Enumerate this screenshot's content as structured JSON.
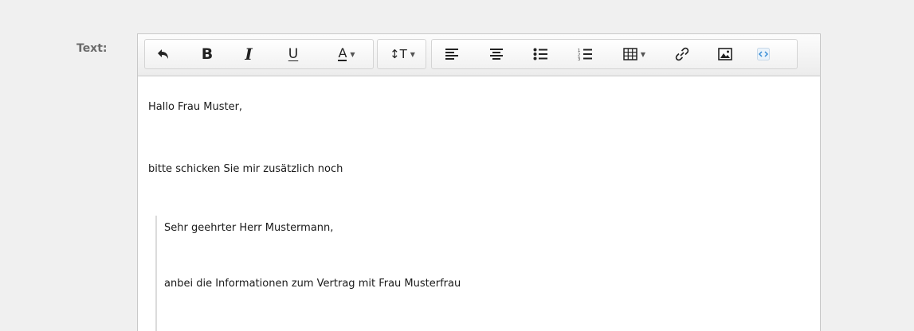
{
  "field": {
    "label": "Text:"
  },
  "toolbar": {
    "groups": [
      {
        "name": "formatting",
        "buttons": [
          {
            "id": "undo",
            "icon": "undo-icon"
          },
          {
            "id": "bold",
            "icon": "bold-icon",
            "glyph": "B"
          },
          {
            "id": "italic",
            "icon": "italic-icon",
            "glyph": "I"
          },
          {
            "id": "underline",
            "icon": "underline-icon",
            "glyph": "U"
          },
          {
            "id": "font-color",
            "icon": "font-color-icon",
            "glyph": "A"
          }
        ]
      },
      {
        "name": "font-size",
        "buttons": [
          {
            "id": "font-size",
            "icon": "font-size-icon",
            "glyph": "↕T"
          }
        ]
      },
      {
        "name": "paragraph",
        "buttons": [
          {
            "id": "align-left",
            "icon": "align-left-icon"
          },
          {
            "id": "align-center",
            "icon": "align-center-icon"
          },
          {
            "id": "bullet-list",
            "icon": "bullet-list-icon"
          },
          {
            "id": "numbered-list",
            "icon": "numbered-list-icon"
          },
          {
            "id": "table",
            "icon": "table-icon"
          },
          {
            "id": "link",
            "icon": "link-icon"
          },
          {
            "id": "image",
            "icon": "image-icon"
          },
          {
            "id": "source",
            "icon": "code-view-icon"
          }
        ]
      }
    ]
  },
  "content": {
    "paragraphs": [
      "Hallo Frau Muster,",
      "bitte schicken Sie mir zusätzlich noch"
    ],
    "quote": [
      "Sehr geehrter Herr Mustermann,",
      "anbei die Informationen zum Vertrag mit Frau Musterfrau"
    ]
  },
  "colors": {
    "label": "#6b6b6b",
    "source_icon": "#3b8fd6",
    "background": "#f0f0f0"
  }
}
